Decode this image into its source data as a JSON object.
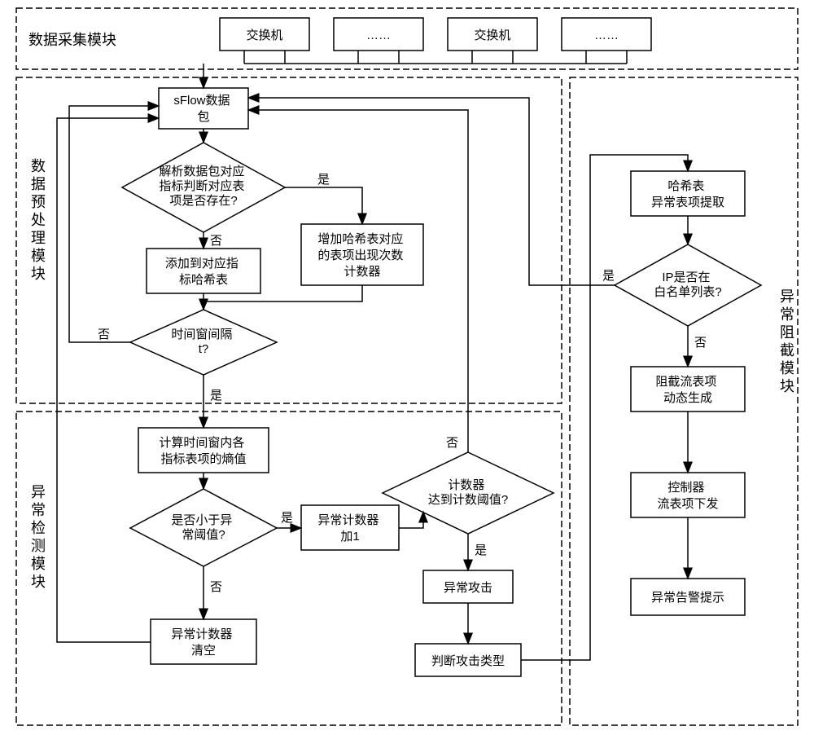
{
  "modules": {
    "collect": "数据采集模块",
    "preprocess": "数据预处理模块",
    "detect": "异常检测模块",
    "block": "异常阻截模块"
  },
  "collect": {
    "switch1": "交换机",
    "dots1": "……",
    "switch2": "交换机",
    "dots2": "……"
  },
  "preprocess": {
    "sflow_l1": "sFlow数据",
    "sflow_l2": "包",
    "parse_l1": "解析数据包对应",
    "parse_l2": "指标判断对应表",
    "parse_l3": "项是否存在?",
    "addhash_l1": "添加到对应指",
    "addhash_l2": "标哈希表",
    "inc_l1": "增加哈希表对应",
    "inc_l2": "的表项出现次数",
    "inc_l3": "计数器",
    "window_l1": "时间窗间隔",
    "window_l2": "t?"
  },
  "detect": {
    "entropy_l1": "计算时间窗内各",
    "entropy_l2": "指标表项的熵值",
    "threshold_l1": "是否小于异",
    "threshold_l2": "常阈值?",
    "clear_l1": "异常计数器",
    "clear_l2": "清空",
    "inc_l1": "异常计数器",
    "inc_l2": "加1",
    "count_l1": "计数器",
    "count_l2": "达到计数阈值?",
    "attack": "异常攻击",
    "type": "判断攻击类型"
  },
  "block": {
    "extract_l1": "哈希表",
    "extract_l2": "异常表项提取",
    "whitelist_l1": "IP是否在",
    "whitelist_l2": "白名单列表?",
    "flow_l1": "阻截流表项",
    "flow_l2": "动态生成",
    "ctrl_l1": "控制器",
    "ctrl_l2": "流表项下发",
    "alert": "异常告警提示"
  },
  "labels": {
    "yes": "是",
    "no": "否"
  }
}
